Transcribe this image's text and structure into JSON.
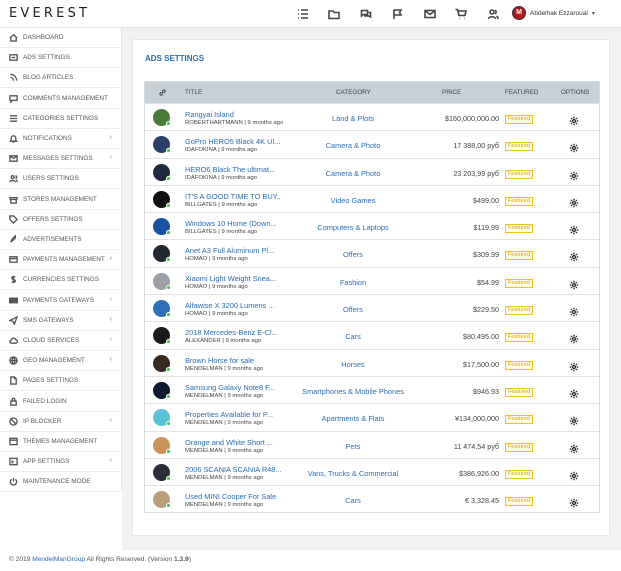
{
  "brand": "EVEREST",
  "top_icons": [
    "list-icon",
    "folder-icon",
    "chat-icon",
    "flag-icon",
    "mail-icon",
    "cart-icon",
    "users-icon"
  ],
  "user": {
    "name": "Abdelhak Ezzaroual",
    "avatar_letter": "M"
  },
  "sidebar": {
    "items": [
      {
        "label": "DASHBOARD",
        "icon": "home-icon",
        "chev": false
      },
      {
        "label": "ADS SETTINGS",
        "icon": "ads-icon",
        "chev": false
      },
      {
        "label": "BLOG ARTICLES",
        "icon": "rss-icon",
        "chev": false
      },
      {
        "label": "COMMENTS MANAGEMENT",
        "icon": "comment-icon",
        "chev": false
      },
      {
        "label": "CATEGORIES SETTINGS",
        "icon": "list-icon",
        "chev": false
      },
      {
        "label": "NOTIFICATIONS",
        "icon": "bell-icon",
        "chev": true
      },
      {
        "label": "MESSAGES SETTINGS",
        "icon": "envelope-icon",
        "chev": true
      },
      {
        "label": "USERS SETTINGS",
        "icon": "users-icon",
        "chev": false
      },
      {
        "label": "STORES MANAGEMENT",
        "icon": "store-icon",
        "chev": false
      },
      {
        "label": "OFFERS SETTINGS",
        "icon": "tag-icon",
        "chev": false
      },
      {
        "label": "ADVERTISEMENTS",
        "icon": "rocket-icon",
        "chev": false
      },
      {
        "label": "PAYMENTS MANAGEMENT",
        "icon": "card-icon",
        "chev": true
      },
      {
        "label": "CURRENCIES SETTINGS",
        "icon": "dollar-icon",
        "chev": false
      },
      {
        "label": "PAYMENTS GATEWAYS",
        "icon": "gateway-icon",
        "chev": true
      },
      {
        "label": "SMS GATEWAYS",
        "icon": "send-icon",
        "chev": true
      },
      {
        "label": "CLOUD SERVICES",
        "icon": "cloud-icon",
        "chev": true
      },
      {
        "label": "GEO MANAGEMENT",
        "icon": "globe-icon",
        "chev": true
      },
      {
        "label": "PAGES SETTINGS",
        "icon": "page-icon",
        "chev": false
      },
      {
        "label": "FAILED LOGIN",
        "icon": "lock-icon",
        "chev": false
      },
      {
        "label": "IP BLOCKER",
        "icon": "ban-icon",
        "chev": true
      },
      {
        "label": "THEMES MANAGEMENT",
        "icon": "theme-icon",
        "chev": false
      },
      {
        "label": "APP SETTINGS",
        "icon": "app-icon",
        "chev": true
      },
      {
        "label": "MAINTENANCE MODE",
        "icon": "power-icon",
        "chev": false
      }
    ]
  },
  "card": {
    "title": "ADS SETTINGS"
  },
  "table": {
    "headers": {
      "title": "TITLE",
      "category": "CATEGORY",
      "price": "PRICE",
      "featured": "FEATURED",
      "options": "OPTIONS"
    },
    "rows": [
      {
        "title": "Rangyai Island",
        "user": "ROBERTHARTMANN",
        "time": "9 months ago",
        "category": "Land & Plots",
        "price": "$160,000,000.00",
        "featured": "Featured",
        "thumb": "#4a7a3a"
      },
      {
        "title": "GoPro HERO5 Black 4K Ul...",
        "user": "IDAFOKINA",
        "time": "9 months ago",
        "category": "Camera & Photo",
        "price": "17 388,00 руб",
        "featured": "Featured",
        "thumb": "#2b3f66"
      },
      {
        "title": "HERO6 Black The ultimat...",
        "user": "IDAFOKINA",
        "time": "9 months ago",
        "category": "Camera & Photo",
        "price": "23 203,99 руб",
        "featured": "Featured",
        "thumb": "#1f2a3c"
      },
      {
        "title": "IT'S A GOOD TIME TO BUY...",
        "user": "BILLGATES",
        "time": "9 months ago",
        "category": "Video Games",
        "price": "$499,00",
        "featured": "Featured",
        "thumb": "#111111"
      },
      {
        "title": "Windows 10 Home (Down...",
        "user": "BILLGATES",
        "time": "9 months ago",
        "category": "Computers & Laptops",
        "price": "$119,99",
        "featured": "Featured",
        "thumb": "#1b4fa0"
      },
      {
        "title": "Anet A3 Full Aluminum Pl...",
        "user": "HOMAO",
        "time": "9 months ago",
        "category": "Offers",
        "price": "$309.99",
        "featured": "Featured",
        "thumb": "#222831"
      },
      {
        "title": "Xiaomi Light Weight Snea...",
        "user": "HOMAO",
        "time": "9 months ago",
        "category": "Fashion",
        "price": "$54.99",
        "featured": "Featured",
        "thumb": "#9aa0a6"
      },
      {
        "title": "Alfawise X 3200 Lumens ...",
        "user": "HOMAO",
        "time": "9 months ago",
        "category": "Offers",
        "price": "$229.50",
        "featured": "Featured",
        "thumb": "#2d6fb3"
      },
      {
        "title": "2018 Mercedes-Benz E-Cl...",
        "user": "ALEXANDER",
        "time": "9 months ago",
        "category": "Cars",
        "price": "$80,495.00",
        "featured": "Featured",
        "thumb": "#1a1a1a"
      },
      {
        "title": "Brown Horse for sale",
        "user": "MENDELMAN",
        "time": "9 months ago",
        "category": "Horses",
        "price": "$17,500.00",
        "featured": "Featured",
        "thumb": "#3a2a1e"
      },
      {
        "title": "Samsung Galaxy Note8 F...",
        "user": "MENDELMAN",
        "time": "9 months ago",
        "category": "Smartphones & Mobile Phones",
        "price": "$946.93",
        "featured": "Featured",
        "thumb": "#0d1a2e"
      },
      {
        "title": "Properties Available for P...",
        "user": "MENDELMAN",
        "time": "9 months ago",
        "category": "Apartments & Flats",
        "price": "¥134,000,000",
        "featured": "Featured",
        "thumb": "#59c3d6"
      },
      {
        "title": "Orange and White Short ...",
        "user": "MENDELMAN",
        "time": "9 months ago",
        "category": "Pets",
        "price": "11 474,54 руб",
        "featured": "Featured",
        "thumb": "#c9925a"
      },
      {
        "title": "2006 SCANIA SCANIA R48...",
        "user": "MENDELMAN",
        "time": "9 months ago",
        "category": "Vans, Trucks & Commercial",
        "price": "$386,926.00",
        "featured": "Featured",
        "thumb": "#2a2f3a"
      },
      {
        "title": "Used MINI Cooper For Sale",
        "user": "MENDELMAN",
        "time": "9 months ago",
        "category": "Cars",
        "price": "€ 3,328.45",
        "featured": "Featured",
        "thumb": "#b9a07a"
      }
    ]
  },
  "footer": {
    "prefix": "© 2019 ",
    "company": "MendelManGroup",
    "middle": " All Rights Reserved. (Version ",
    "version": "1.3.9",
    "suffix": ")"
  },
  "colors": {
    "link": "#2a6db5",
    "online": "#2ecc40",
    "featured_border": "#f0c419"
  }
}
